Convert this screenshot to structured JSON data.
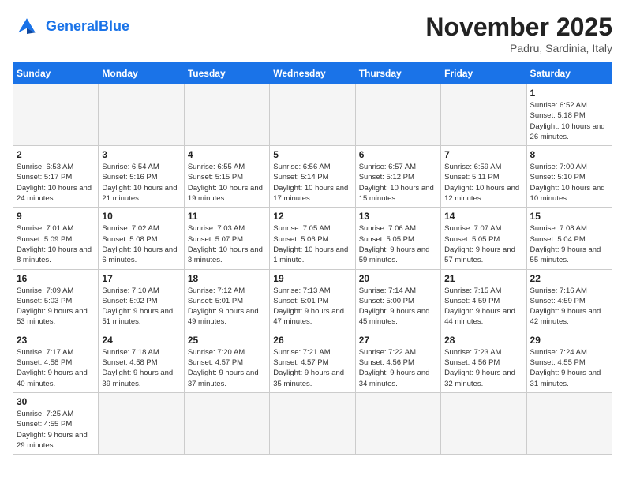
{
  "header": {
    "logo_general": "General",
    "logo_blue": "Blue",
    "month_title": "November 2025",
    "subtitle": "Padru, Sardinia, Italy"
  },
  "days_of_week": [
    "Sunday",
    "Monday",
    "Tuesday",
    "Wednesday",
    "Thursday",
    "Friday",
    "Saturday"
  ],
  "weeks": [
    [
      {
        "day": "",
        "sunrise": "",
        "sunset": "",
        "daylight": "",
        "empty": true
      },
      {
        "day": "",
        "sunrise": "",
        "sunset": "",
        "daylight": "",
        "empty": true
      },
      {
        "day": "",
        "sunrise": "",
        "sunset": "",
        "daylight": "",
        "empty": true
      },
      {
        "day": "",
        "sunrise": "",
        "sunset": "",
        "daylight": "",
        "empty": true
      },
      {
        "day": "",
        "sunrise": "",
        "sunset": "",
        "daylight": "",
        "empty": true
      },
      {
        "day": "",
        "sunrise": "",
        "sunset": "",
        "daylight": "",
        "empty": true
      },
      {
        "day": "1",
        "sunrise": "Sunrise: 6:52 AM",
        "sunset": "Sunset: 5:18 PM",
        "daylight": "Daylight: 10 hours and 26 minutes.",
        "empty": false
      }
    ],
    [
      {
        "day": "2",
        "sunrise": "Sunrise: 6:53 AM",
        "sunset": "Sunset: 5:17 PM",
        "daylight": "Daylight: 10 hours and 24 minutes.",
        "empty": false
      },
      {
        "day": "3",
        "sunrise": "Sunrise: 6:54 AM",
        "sunset": "Sunset: 5:16 PM",
        "daylight": "Daylight: 10 hours and 21 minutes.",
        "empty": false
      },
      {
        "day": "4",
        "sunrise": "Sunrise: 6:55 AM",
        "sunset": "Sunset: 5:15 PM",
        "daylight": "Daylight: 10 hours and 19 minutes.",
        "empty": false
      },
      {
        "day": "5",
        "sunrise": "Sunrise: 6:56 AM",
        "sunset": "Sunset: 5:14 PM",
        "daylight": "Daylight: 10 hours and 17 minutes.",
        "empty": false
      },
      {
        "day": "6",
        "sunrise": "Sunrise: 6:57 AM",
        "sunset": "Sunset: 5:12 PM",
        "daylight": "Daylight: 10 hours and 15 minutes.",
        "empty": false
      },
      {
        "day": "7",
        "sunrise": "Sunrise: 6:59 AM",
        "sunset": "Sunset: 5:11 PM",
        "daylight": "Daylight: 10 hours and 12 minutes.",
        "empty": false
      },
      {
        "day": "8",
        "sunrise": "Sunrise: 7:00 AM",
        "sunset": "Sunset: 5:10 PM",
        "daylight": "Daylight: 10 hours and 10 minutes.",
        "empty": false
      }
    ],
    [
      {
        "day": "9",
        "sunrise": "Sunrise: 7:01 AM",
        "sunset": "Sunset: 5:09 PM",
        "daylight": "Daylight: 10 hours and 8 minutes.",
        "empty": false
      },
      {
        "day": "10",
        "sunrise": "Sunrise: 7:02 AM",
        "sunset": "Sunset: 5:08 PM",
        "daylight": "Daylight: 10 hours and 6 minutes.",
        "empty": false
      },
      {
        "day": "11",
        "sunrise": "Sunrise: 7:03 AM",
        "sunset": "Sunset: 5:07 PM",
        "daylight": "Daylight: 10 hours and 3 minutes.",
        "empty": false
      },
      {
        "day": "12",
        "sunrise": "Sunrise: 7:05 AM",
        "sunset": "Sunset: 5:06 PM",
        "daylight": "Daylight: 10 hours and 1 minute.",
        "empty": false
      },
      {
        "day": "13",
        "sunrise": "Sunrise: 7:06 AM",
        "sunset": "Sunset: 5:05 PM",
        "daylight": "Daylight: 9 hours and 59 minutes.",
        "empty": false
      },
      {
        "day": "14",
        "sunrise": "Sunrise: 7:07 AM",
        "sunset": "Sunset: 5:05 PM",
        "daylight": "Daylight: 9 hours and 57 minutes.",
        "empty": false
      },
      {
        "day": "15",
        "sunrise": "Sunrise: 7:08 AM",
        "sunset": "Sunset: 5:04 PM",
        "daylight": "Daylight: 9 hours and 55 minutes.",
        "empty": false
      }
    ],
    [
      {
        "day": "16",
        "sunrise": "Sunrise: 7:09 AM",
        "sunset": "Sunset: 5:03 PM",
        "daylight": "Daylight: 9 hours and 53 minutes.",
        "empty": false
      },
      {
        "day": "17",
        "sunrise": "Sunrise: 7:10 AM",
        "sunset": "Sunset: 5:02 PM",
        "daylight": "Daylight: 9 hours and 51 minutes.",
        "empty": false
      },
      {
        "day": "18",
        "sunrise": "Sunrise: 7:12 AM",
        "sunset": "Sunset: 5:01 PM",
        "daylight": "Daylight: 9 hours and 49 minutes.",
        "empty": false
      },
      {
        "day": "19",
        "sunrise": "Sunrise: 7:13 AM",
        "sunset": "Sunset: 5:01 PM",
        "daylight": "Daylight: 9 hours and 47 minutes.",
        "empty": false
      },
      {
        "day": "20",
        "sunrise": "Sunrise: 7:14 AM",
        "sunset": "Sunset: 5:00 PM",
        "daylight": "Daylight: 9 hours and 45 minutes.",
        "empty": false
      },
      {
        "day": "21",
        "sunrise": "Sunrise: 7:15 AM",
        "sunset": "Sunset: 4:59 PM",
        "daylight": "Daylight: 9 hours and 44 minutes.",
        "empty": false
      },
      {
        "day": "22",
        "sunrise": "Sunrise: 7:16 AM",
        "sunset": "Sunset: 4:59 PM",
        "daylight": "Daylight: 9 hours and 42 minutes.",
        "empty": false
      }
    ],
    [
      {
        "day": "23",
        "sunrise": "Sunrise: 7:17 AM",
        "sunset": "Sunset: 4:58 PM",
        "daylight": "Daylight: 9 hours and 40 minutes.",
        "empty": false
      },
      {
        "day": "24",
        "sunrise": "Sunrise: 7:18 AM",
        "sunset": "Sunset: 4:58 PM",
        "daylight": "Daylight: 9 hours and 39 minutes.",
        "empty": false
      },
      {
        "day": "25",
        "sunrise": "Sunrise: 7:20 AM",
        "sunset": "Sunset: 4:57 PM",
        "daylight": "Daylight: 9 hours and 37 minutes.",
        "empty": false
      },
      {
        "day": "26",
        "sunrise": "Sunrise: 7:21 AM",
        "sunset": "Sunset: 4:57 PM",
        "daylight": "Daylight: 9 hours and 35 minutes.",
        "empty": false
      },
      {
        "day": "27",
        "sunrise": "Sunrise: 7:22 AM",
        "sunset": "Sunset: 4:56 PM",
        "daylight": "Daylight: 9 hours and 34 minutes.",
        "empty": false
      },
      {
        "day": "28",
        "sunrise": "Sunrise: 7:23 AM",
        "sunset": "Sunset: 4:56 PM",
        "daylight": "Daylight: 9 hours and 32 minutes.",
        "empty": false
      },
      {
        "day": "29",
        "sunrise": "Sunrise: 7:24 AM",
        "sunset": "Sunset: 4:55 PM",
        "daylight": "Daylight: 9 hours and 31 minutes.",
        "empty": false
      }
    ],
    [
      {
        "day": "30",
        "sunrise": "Sunrise: 7:25 AM",
        "sunset": "Sunset: 4:55 PM",
        "daylight": "Daylight: 9 hours and 29 minutes.",
        "empty": false
      },
      {
        "day": "",
        "sunrise": "",
        "sunset": "",
        "daylight": "",
        "empty": true
      },
      {
        "day": "",
        "sunrise": "",
        "sunset": "",
        "daylight": "",
        "empty": true
      },
      {
        "day": "",
        "sunrise": "",
        "sunset": "",
        "daylight": "",
        "empty": true
      },
      {
        "day": "",
        "sunrise": "",
        "sunset": "",
        "daylight": "",
        "empty": true
      },
      {
        "day": "",
        "sunrise": "",
        "sunset": "",
        "daylight": "",
        "empty": true
      },
      {
        "day": "",
        "sunrise": "",
        "sunset": "",
        "daylight": "",
        "empty": true
      }
    ]
  ]
}
